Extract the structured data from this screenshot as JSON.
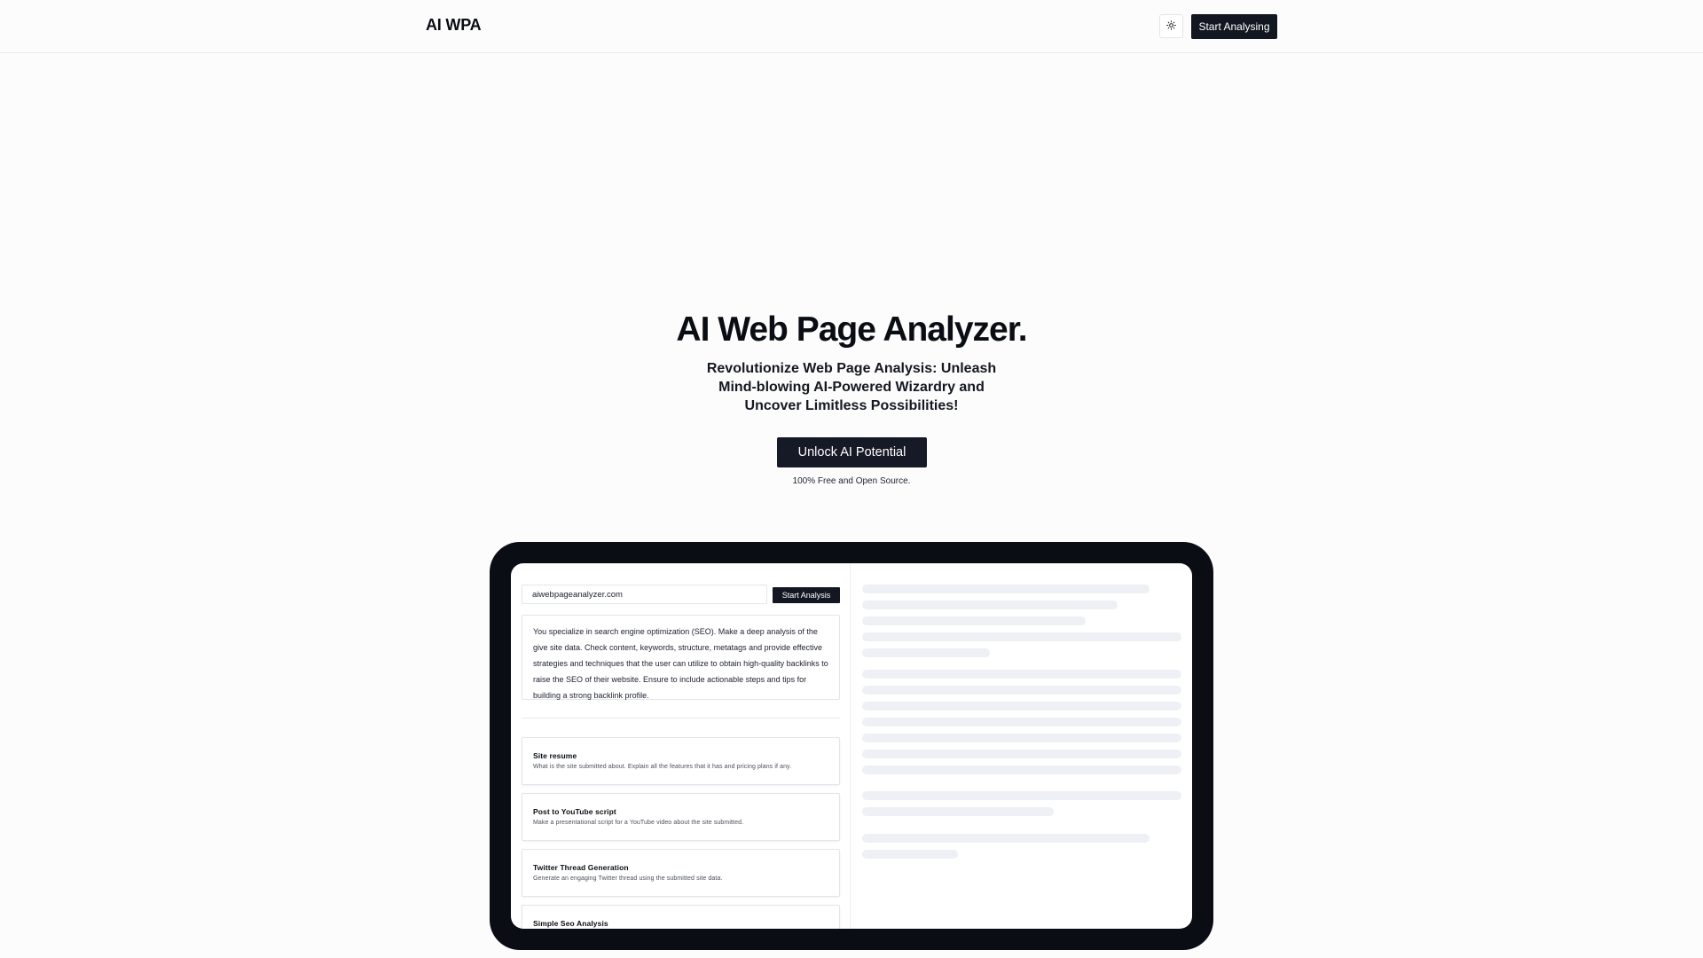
{
  "header": {
    "brand": "AI WPA",
    "theme_icon": "sun-icon",
    "cta_label": "Start Analysing"
  },
  "hero": {
    "title": "AI Web Page Analyzer.",
    "subtitle": "Revolutionize Web Page Analysis: Unleash Mind-blowing AI-Powered Wizardry and Uncover Limitless Possibilities!",
    "cta_label": "Unlock AI Potential",
    "note": "100% Free and Open Source."
  },
  "demo": {
    "url_value": "aiwebpageanalyzer.com",
    "analyze_label": "Start Analysis",
    "prompt": "You specialize in search engine optimization (SEO). Make a deep analysis of the give site data. Check content, keywords, structure, metatags and provide effective strategies and techniques that the user can utilize to obtain high-quality backlinks to raise the SEO of their website. Ensure to include actionable steps and tips for building a strong backlink profile.",
    "cards": [
      {
        "title": "Site resume",
        "desc": "What is the site submitted about. Explain all the features that it has and pricing plans if any."
      },
      {
        "title": "Post to YouTube script",
        "desc": "Make a presentational script for a YouTube video about the site submitted."
      },
      {
        "title": "Twitter Thread Generation",
        "desc": "Generate an engaging Twitter thread using the submitted site data."
      },
      {
        "title": "Simple Seo Analysis",
        "desc": ""
      }
    ]
  },
  "colors": {
    "primary": "#131722",
    "device_frame": "#0b0d14",
    "skeleton": "#eef0f5",
    "background": "#fcfcfc"
  }
}
